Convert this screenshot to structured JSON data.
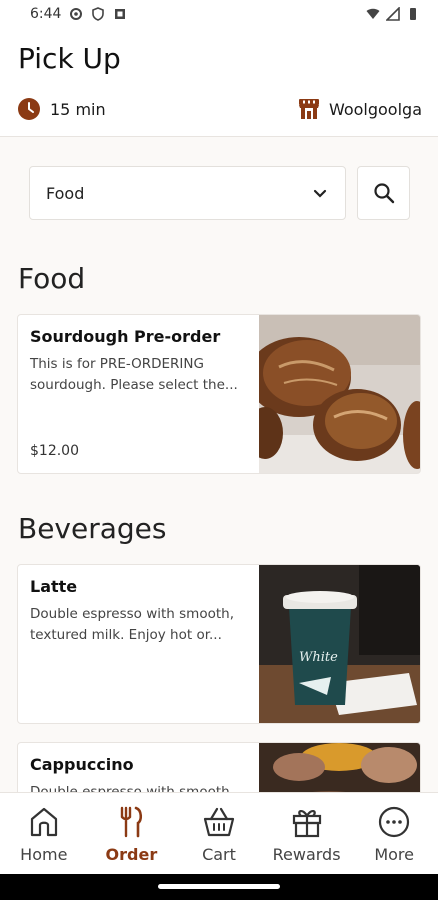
{
  "status_bar": {
    "time": "6:44",
    "left_icons": [
      "settings-icon",
      "shield-icon",
      "square-icon"
    ],
    "right_icons": [
      "wifi-icon",
      "signal-icon",
      "battery-icon"
    ]
  },
  "header": {
    "title": "Pick Up",
    "time_estimate": "15 min",
    "store_name": "Woolgoolga",
    "accent_color": "#8b3a14"
  },
  "filter": {
    "category_selected": "Food"
  },
  "sections": [
    {
      "title": "Food",
      "items": [
        {
          "name": "Sourdough Pre-order",
          "description": "This is for PRE-ORDERING sourdough. Please select the...",
          "price": "$12.00",
          "image": "sourdough-bread-photo"
        }
      ]
    },
    {
      "title": "Beverages",
      "items": [
        {
          "name": "Latte",
          "description": "Double espresso with smooth, textured milk. Enjoy hot or...",
          "image": "latte-cup-photo"
        },
        {
          "name": "Cappuccino",
          "description": "Double espresso with smooth",
          "image": "cappuccino-photo"
        }
      ]
    }
  ],
  "bottom_nav": [
    {
      "label": "Home",
      "icon": "home-icon",
      "active": false
    },
    {
      "label": "Order",
      "icon": "fork-knife-icon",
      "active": true
    },
    {
      "label": "Cart",
      "icon": "basket-icon",
      "active": false
    },
    {
      "label": "Rewards",
      "icon": "gift-icon",
      "active": false
    },
    {
      "label": "More",
      "icon": "more-dots-icon",
      "active": false
    }
  ]
}
